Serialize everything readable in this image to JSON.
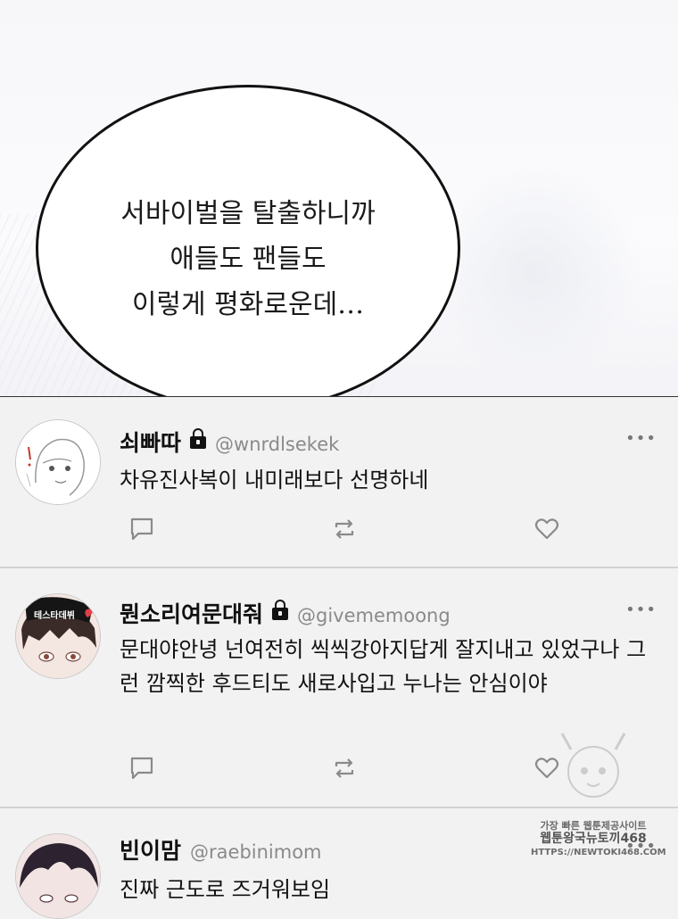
{
  "speech_bubble": {
    "lines": [
      "서바이벌을 탈출하니까",
      "애들도 팬들도",
      "이렇게 평화로운데…"
    ]
  },
  "tweets": [
    {
      "name": "쇠빠따",
      "handle": "@wnrdlsekek",
      "locked": true,
      "text": "차유진사복이 내미래보다 선명하네"
    },
    {
      "name": "뭔소리여문대줘",
      "handle": "@givememoong",
      "locked": true,
      "avatar_tag": "테스타데뷔",
      "text": "문대야안녕 넌여전히 씩씩강아지답게 잘지내고 있었구나 그런 깜찍한 후드티도 새로사입고 누나는 안심이야"
    },
    {
      "name": "빈이맘",
      "handle": "@raebinimom",
      "locked": false,
      "text": "진짜 근도로 즈거워보임"
    }
  ],
  "more_label": "•••",
  "watermark": {
    "line1": "가장 빠른 웹툰제공사이트",
    "line2": "웹툰왕국뉴토끼468",
    "line3": "HTTPS://NEWTOKI468.COM"
  },
  "colors": {
    "panel_bg": "#f2f2f2",
    "divider": "#d2d2d2",
    "icon": "#8a8a8a",
    "handle": "#8a8a8a"
  }
}
